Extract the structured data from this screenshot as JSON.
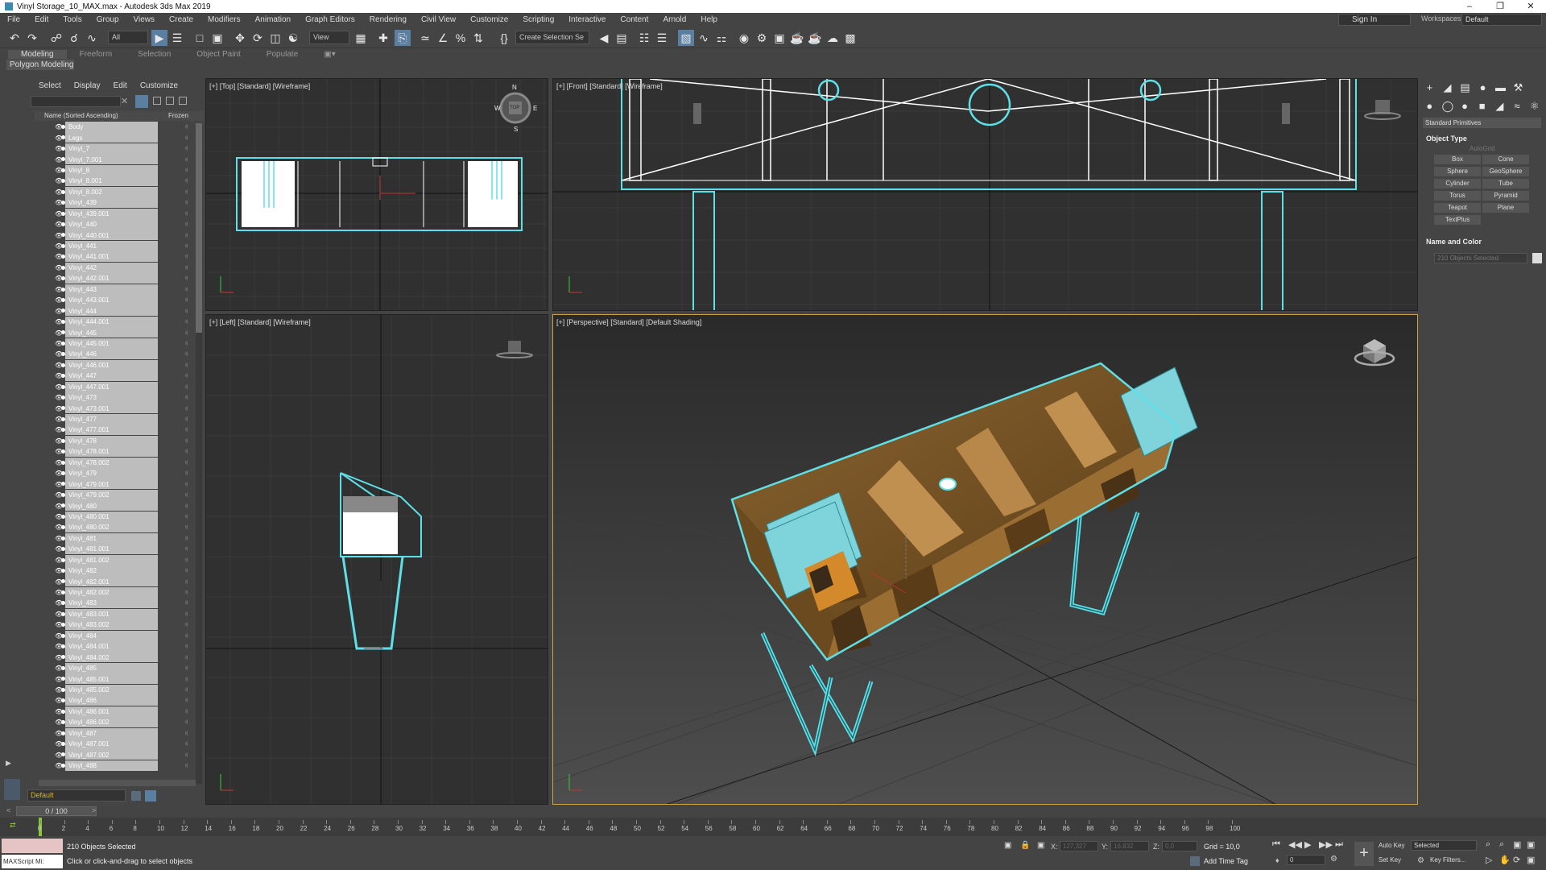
{
  "window": {
    "title": "Vinyl Storage_10_MAX.max - Autodesk 3ds Max 2019"
  },
  "menu": [
    "File",
    "Edit",
    "Tools",
    "Group",
    "Views",
    "Create",
    "Modifiers",
    "Animation",
    "Graph Editors",
    "Rendering",
    "Civil View",
    "Customize",
    "Scripting",
    "Interactive",
    "Content",
    "Arnold",
    "Help"
  ],
  "account": {
    "sign_in": "Sign In",
    "workspaces_label": "Workspaces:",
    "workspace": "Default"
  },
  "toolbar": {
    "selection_filter": "All",
    "ref_coord": "View",
    "named_selection": "Create Selection Se"
  },
  "ribbon": {
    "tabs": [
      "Modeling",
      "Freeform",
      "Selection",
      "Object Paint",
      "Populate"
    ],
    "sub": "Polygon Modeling"
  },
  "scene_explorer": {
    "tabs": [
      "Select",
      "Display",
      "Edit",
      "Customize"
    ],
    "col_name": "Name (Sorted Ascending)",
    "col_frozen": "Frozen",
    "objects": [
      "Body",
      "Legs",
      "Vinyl_7",
      "Vinyl_7.001",
      "Vinyl_8",
      "Vinyl_8.001",
      "Vinyl_8.002",
      "Vinyl_439",
      "Vinyl_439.001",
      "Vinyl_440",
      "Vinyl_440.001",
      "Vinyl_441",
      "Vinyl_441.001",
      "Vinyl_442",
      "Vinyl_442.001",
      "Vinyl_443",
      "Vinyl_443.001",
      "Vinyl_444",
      "Vinyl_444.001",
      "Vinyl_445",
      "Vinyl_445.001",
      "Vinyl_446",
      "Vinyl_446.001",
      "Vinyl_447",
      "Vinyl_447.001",
      "Vinyl_473",
      "Vinyl_473.001",
      "Vinyl_477",
      "Vinyl_477.001",
      "Vinyl_478",
      "Vinyl_478.001",
      "Vinyl_478.002",
      "Vinyl_479",
      "Vinyl_479.001",
      "Vinyl_479.002",
      "Vinyl_480",
      "Vinyl_480.001",
      "Vinyl_480.002",
      "Vinyl_481",
      "Vinyl_481.001",
      "Vinyl_481.002",
      "Vinyl_482",
      "Vinyl_482.001",
      "Vinyl_482.002",
      "Vinyl_483",
      "Vinyl_483.001",
      "Vinyl_483.002",
      "Vinyl_484",
      "Vinyl_484.001",
      "Vinyl_484.002",
      "Vinyl_485",
      "Vinyl_485.001",
      "Vinyl_485.002",
      "Vinyl_486",
      "Vinyl_486.001",
      "Vinyl_486.002",
      "Vinyl_487",
      "Vinyl_487.001",
      "Vinyl_487.002",
      "Vinyl_488"
    ],
    "layer": "Default"
  },
  "viewports": {
    "top": "[+] [Top] [Standard] [Wireframe]",
    "front": "[+] [Front] [Standard] [Wireframe]",
    "left": "[+] [Left] [Standard] [Wireframe]",
    "persp": "[+] [Perspective] [Standard] [Default Shading]",
    "compass": {
      "n": "N",
      "w": "W",
      "e": "E",
      "s": "S",
      "cube": "TOP"
    }
  },
  "command_panel": {
    "category": "Standard Primitives",
    "object_type": "Object Type",
    "autogrid": "AutoGrid",
    "primitives": [
      "Box",
      "Cone",
      "Sphere",
      "GeoSphere",
      "Cylinder",
      "Tube",
      "Torus",
      "Pyramid",
      "Teapot",
      "Plane",
      "TextPlus"
    ],
    "name_color": "Name and Color",
    "name_value": "210 Objects Selected"
  },
  "timeline": {
    "frame": "0 / 100",
    "ticks": [
      "0",
      "2",
      "4",
      "6",
      "8",
      "10",
      "12",
      "14",
      "16",
      "18",
      "20",
      "22",
      "24",
      "26",
      "28",
      "30",
      "32",
      "34",
      "36",
      "38",
      "40",
      "42",
      "44",
      "46",
      "48",
      "50",
      "52",
      "54",
      "56",
      "58",
      "60",
      "62",
      "64",
      "66",
      "68",
      "70",
      "72",
      "74",
      "76",
      "78",
      "80",
      "82",
      "84",
      "86",
      "88",
      "90",
      "92",
      "94",
      "96",
      "98",
      "100"
    ]
  },
  "status": {
    "maxscript": "MAXScript Mi:",
    "selected": "210 Objects Selected",
    "prompt": "Click or click-and-drag to select objects",
    "x_label": "X:",
    "x_value": "127,327",
    "y_label": "Y:",
    "y_value": "16,832",
    "z_label": "Z:",
    "z_value": "0,0",
    "grid": "Grid = 10,0",
    "add_time_tag": "Add Time Tag",
    "auto_key": "Auto Key",
    "set_key": "Set Key",
    "selected_dd": "Selected",
    "key_filters": "Key Filters...",
    "frame_value": "0"
  },
  "colors": {
    "selection": "#5ee0e8",
    "active_border": "#c8a838",
    "wood": "#a57a3a"
  }
}
